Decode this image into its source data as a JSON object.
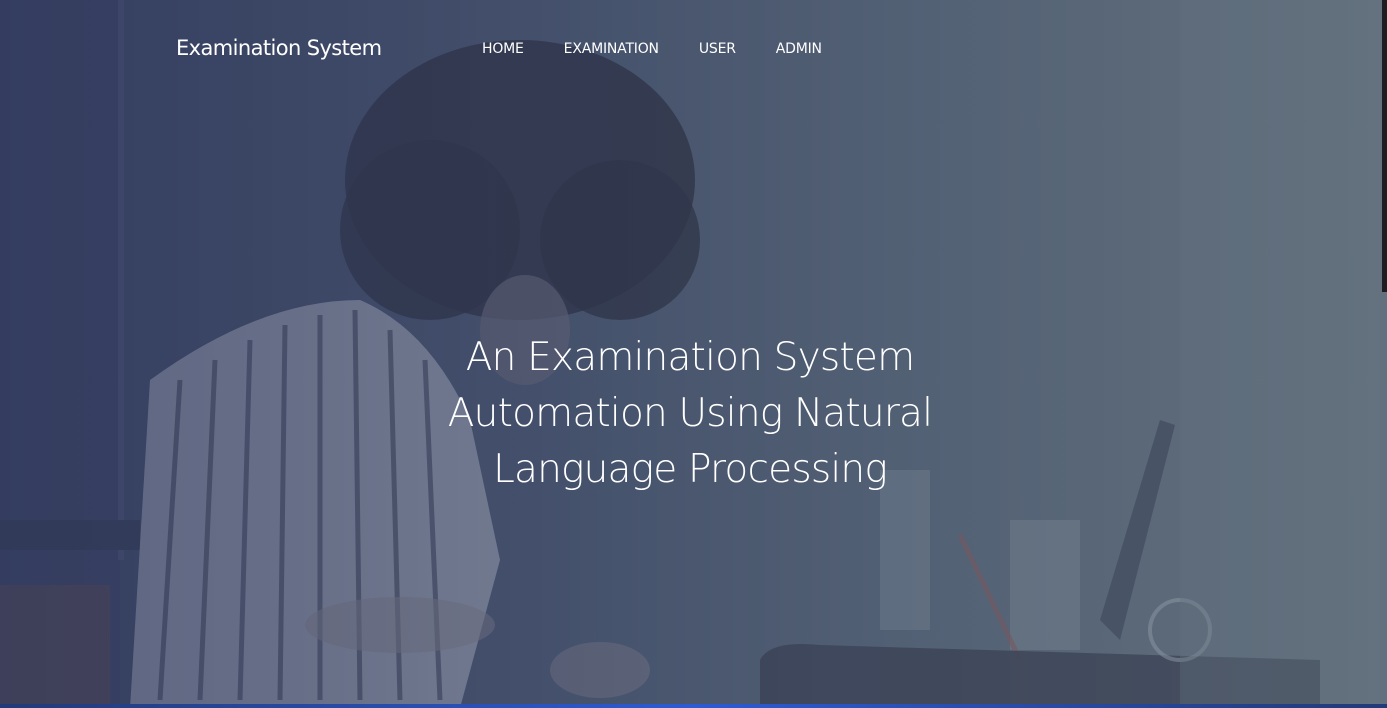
{
  "brand": "Examination System",
  "nav": {
    "items": [
      {
        "label": "HOME"
      },
      {
        "label": "EXAMINATION"
      },
      {
        "label": "USER"
      },
      {
        "label": "ADMIN"
      }
    ]
  },
  "hero": {
    "lines": [
      "An Examination System",
      "Automation Using Natural",
      "Language Processing"
    ]
  },
  "colors": {
    "overlay_left": "#3a4464",
    "overlay_right": "#66737f",
    "text": "#ffffff",
    "bottom_accent": "#2d5bd4"
  }
}
